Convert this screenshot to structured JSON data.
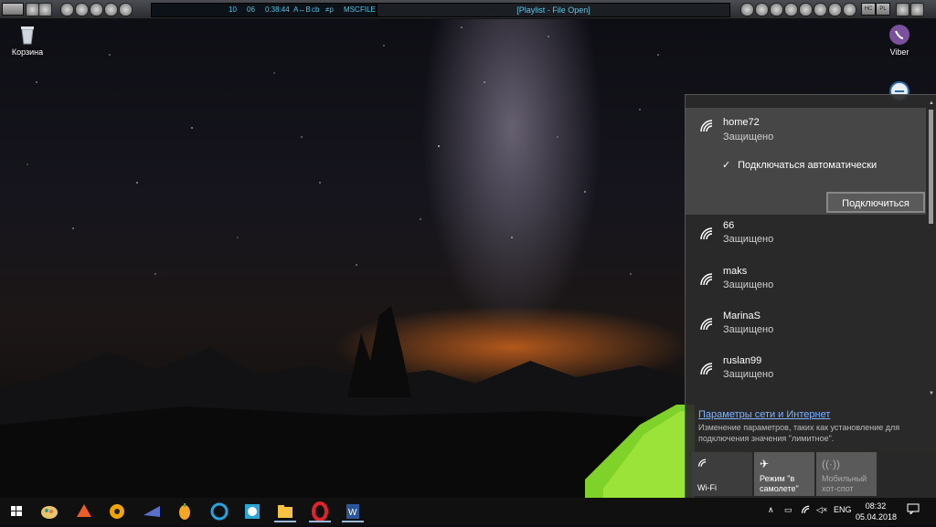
{
  "player": {
    "display": {
      "track_no": "10",
      "num": "06",
      "time": "0:38:44",
      "ab": "A↔B",
      "ch": "cb",
      "eq": "≠p",
      "mode": "MSC",
      "file": "FILE"
    },
    "title": "[Playlist - File Open]",
    "boxes": [
      "HC",
      "PL"
    ]
  },
  "desktop": {
    "icons": [
      {
        "name": "recycle-bin",
        "label": "Корзина"
      },
      {
        "name": "viber",
        "label": "Viber"
      }
    ]
  },
  "network": {
    "active": {
      "name": "home72",
      "status": "Защищено",
      "auto_connect_label": "Подключаться автоматически",
      "connect_label": "Подключиться"
    },
    "list": [
      {
        "name": "66",
        "status": "Защищено"
      },
      {
        "name": "maks",
        "status": "Защищено"
      },
      {
        "name": "MarinaS",
        "status": "Защищено"
      },
      {
        "name": "ruslan99",
        "status": "Защищено"
      }
    ],
    "settings_link": "Параметры сети и Интернет",
    "settings_desc": "Изменение параметров, таких как установление для подключения значения \"лимитное\".",
    "tiles": {
      "wifi": "Wi-Fi",
      "airplane": "Режим \"в самолете\"",
      "hotspot": "Мобильный хот-спот"
    }
  },
  "taskbar": {
    "lang": "ENG",
    "time": "08:32",
    "date": "05.04.2018",
    "tray_up": "∧"
  },
  "colors": {
    "accent": "#7fb3ff",
    "flyout_bg": "#2b2b2b",
    "taskbar_bg": "#101010"
  }
}
